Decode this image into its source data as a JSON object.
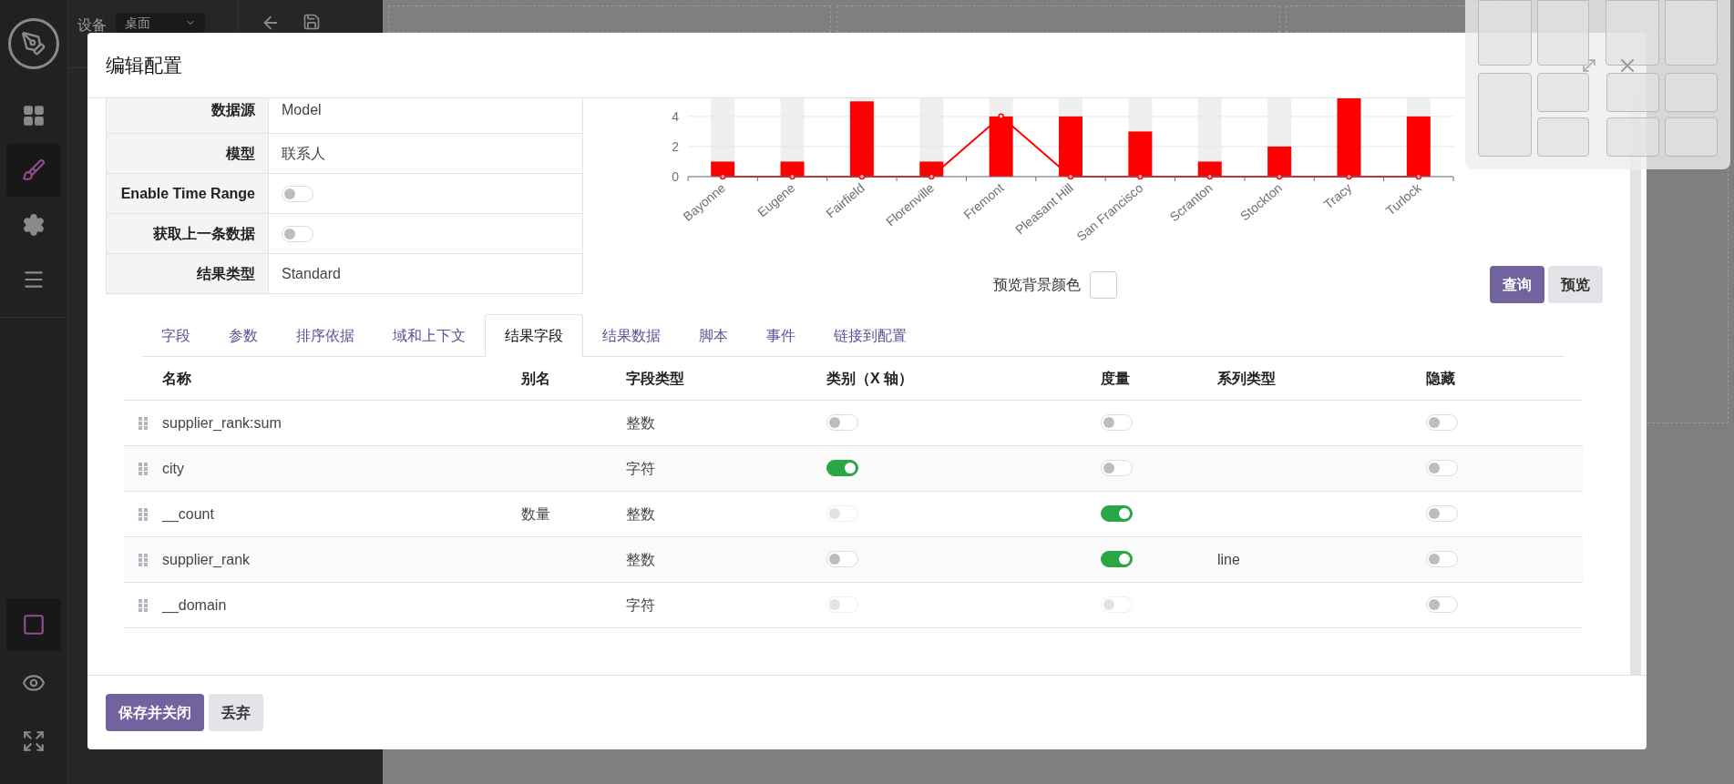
{
  "toolbar": {
    "device_label": "设备",
    "device_value": "桌面"
  },
  "sidebar": {
    "top_items": [
      {
        "selected": false
      },
      {
        "selected": true
      },
      {
        "selected": false
      },
      {
        "selected": false
      }
    ],
    "bottom_items": [
      {
        "selected": true
      },
      {
        "selected": false
      },
      {
        "selected": false
      }
    ]
  },
  "dialog": {
    "title": "编辑配置",
    "properties": [
      {
        "label": "数据源",
        "kind": "text",
        "value": "Model"
      },
      {
        "label": "模型",
        "kind": "text",
        "value": "联系人"
      },
      {
        "label": "Enable Time Range",
        "kind": "toggle",
        "on": false
      },
      {
        "label": "获取上一条数据",
        "kind": "toggle",
        "on": false
      },
      {
        "label": "结果类型",
        "kind": "text",
        "value": "Standard"
      }
    ],
    "chart_data": {
      "type": "bar",
      "categories": [
        "Bayonne",
        "Eugene",
        "Fairfield",
        "Florenville",
        "Fremont",
        "Pleasant Hill",
        "San Francisco",
        "Scranton",
        "Stockton",
        "Tracy",
        "Turlock"
      ],
      "ylim": [
        0,
        5.2
      ],
      "yticks": [
        0,
        2,
        4
      ],
      "series": [
        {
          "type": "bar",
          "color": "#ff0000",
          "values": [
            1,
            1,
            5,
            1,
            4,
            4,
            3,
            1,
            2,
            5.2,
            4
          ]
        },
        {
          "type": "line",
          "color": "#ff0000",
          "marker": true,
          "values": [
            0,
            0,
            0,
            0,
            4,
            0,
            0,
            0,
            0,
            0,
            0
          ]
        }
      ]
    },
    "preview_bg_label": "预览背景颜色",
    "actions": [
      {
        "label": "查询",
        "kind": "primary"
      },
      {
        "label": "预览",
        "kind": "secondary"
      }
    ],
    "tabs": [
      {
        "label": "字段",
        "selected": false
      },
      {
        "label": "参数",
        "selected": false
      },
      {
        "label": "排序依据",
        "selected": false
      },
      {
        "label": "域和上下文",
        "selected": false
      },
      {
        "label": "结果字段",
        "selected": true
      },
      {
        "label": "结果数据",
        "selected": false
      },
      {
        "label": "脚本",
        "selected": false
      },
      {
        "label": "事件",
        "selected": false
      },
      {
        "label": "链接到配置",
        "selected": false
      }
    ],
    "table": {
      "columns": [
        "名称",
        "别名",
        "字段类型",
        "类别（X 轴）",
        "度量",
        "系列类型",
        "隐藏"
      ],
      "rows": [
        {
          "name": "supplier_rank:sum",
          "field_type": "整数",
          "category": {
            "checked": false,
            "disabled": false
          },
          "measure": {
            "checked": false,
            "disabled": false
          },
          "hidden": {
            "checked": false,
            "disabled": false
          }
        },
        {
          "name": "city",
          "field_type": "字符",
          "category": {
            "checked": true,
            "disabled": false
          },
          "measure": {
            "checked": false,
            "disabled": false
          },
          "hidden": {
            "checked": false,
            "disabled": false
          }
        },
        {
          "name": "__count",
          "alias": "数量",
          "field_type": "整数",
          "category": {
            "checked": false,
            "disabled": true
          },
          "measure": {
            "checked": true,
            "disabled": false
          },
          "hidden": {
            "checked": false,
            "disabled": false
          }
        },
        {
          "name": "supplier_rank",
          "field_type": "整数",
          "category": {
            "checked": false,
            "disabled": false
          },
          "measure": {
            "checked": true,
            "disabled": false
          },
          "series_type": "line",
          "hidden": {
            "checked": false,
            "disabled": false
          }
        },
        {
          "name": "__domain",
          "field_type": "字符",
          "category": {
            "checked": false,
            "disabled": true
          },
          "measure": {
            "checked": false,
            "disabled": true
          },
          "hidden": {
            "checked": false,
            "disabled": false
          }
        }
      ]
    },
    "footer_buttons": [
      {
        "label": "保存并关闭",
        "kind": "primary"
      },
      {
        "label": "丢弃",
        "kind": "secondary"
      }
    ]
  }
}
